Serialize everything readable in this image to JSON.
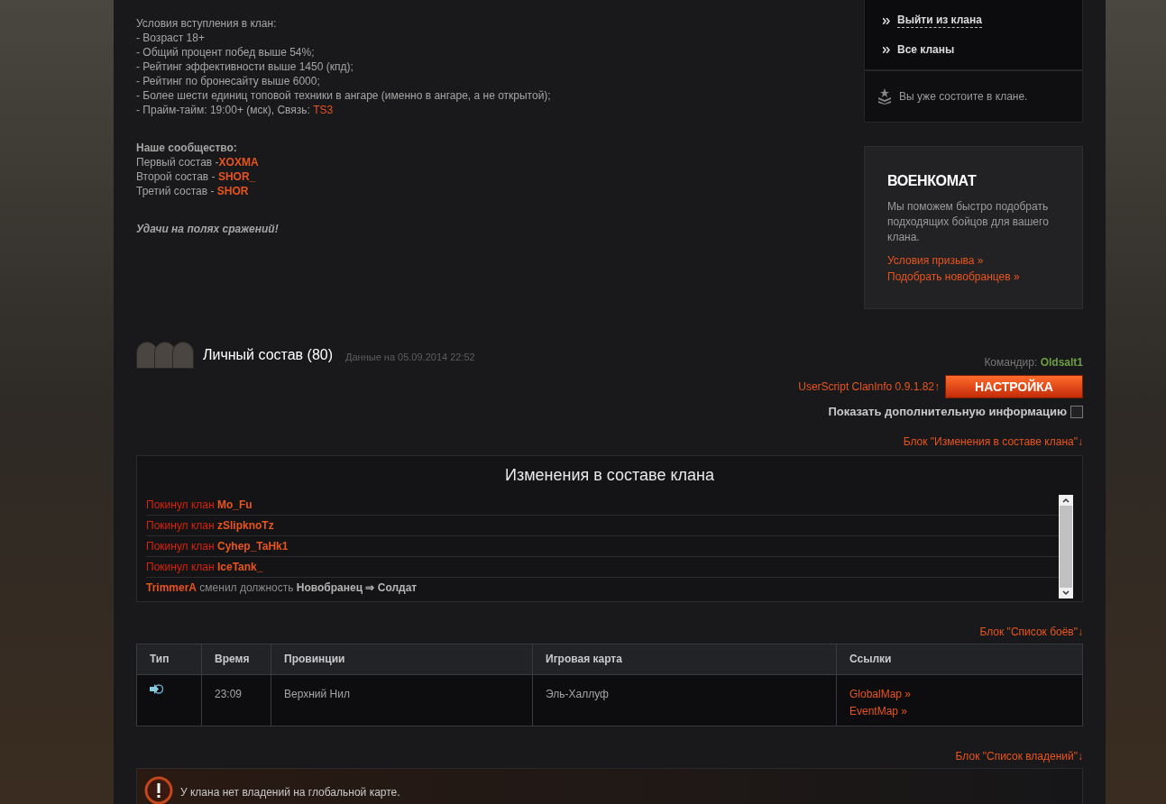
{
  "conditions": {
    "title": "Условия вступления в клан:",
    "lines": [
      {
        "text": "- Возраст 18+"
      },
      {
        "text": "- Общий процент побед выше 54%;"
      },
      {
        "text": "- Рейтинг эффективности выше 1450 (кпд);"
      },
      {
        "text": "- Рейтинг по бронесайту выше 6000;"
      },
      {
        "text": "- Более шести единиц топовой техники в ангаре (именно в ангаре, а не открытой);"
      },
      {
        "text": "- Прайм-тайм: 19:00+ (мск), Связь: ",
        "link": "TS3"
      }
    ]
  },
  "community": {
    "title": "Наше сообщество:",
    "rows": [
      {
        "label": "Первый состав -",
        "tag": "XOXMA"
      },
      {
        "label": "Второй состав - ",
        "tag": "SHOR_"
      },
      {
        "label": "Третий состав - ",
        "tag": "SHOR"
      }
    ]
  },
  "farewell": "Удачи на полях сражений!",
  "clan_actions": [
    {
      "label": "Выйти из клана",
      "dashed": true
    },
    {
      "label": "Все кланы",
      "dashed": false
    }
  ],
  "clan_status": "Вы уже состоите в клане.",
  "recruit": {
    "title": "ВОЕНКОМАТ",
    "text": "Мы поможем быстро подобрать подходящих бойцов для вашего клана.",
    "links": [
      "Условия призыва »",
      "Подобрать новобранцев »"
    ]
  },
  "roster": {
    "title": "Личный состав (80)",
    "date": "Данные на 05.09.2014 22:52",
    "commander_label": "Командир: ",
    "commander": "Oldsalt1",
    "userscript": "UserScript ClanInfo 0.9.1.82↑",
    "settings_button": "НАСТРОЙКА",
    "extra_info": {
      "label": "Показать дополнительную информацию",
      "checked": false
    }
  },
  "changes_block_link": "Блок \"Изменения в составе клана\"↓",
  "changes": {
    "title": "Изменения в составе клана",
    "entries": [
      {
        "kind": "left",
        "action": "Покинул клан ",
        "player": "Mo_Fu"
      },
      {
        "kind": "left",
        "action": "Покинул клан ",
        "player": "zSlipknoTz"
      },
      {
        "kind": "left",
        "action": "Покинул клан ",
        "player": "Cyhep_TaHk1"
      },
      {
        "kind": "left",
        "action": "Покинул клан ",
        "player": "IceTank_"
      },
      {
        "kind": "role",
        "player": "TrimmerA",
        "action": " сменил должность ",
        "change": "Новобранец ⇒ Солдат"
      }
    ]
  },
  "battles_block_link": "Блок \"Список боёв\"↓",
  "battles": {
    "columns": [
      "Тип",
      "Время",
      "Провинции",
      "Игровая карта",
      "Ссылки"
    ],
    "rows": [
      {
        "time": "23:09",
        "province": "Верхний Нил",
        "map": "Эль-Халлуф",
        "links": [
          "GlobalMap »",
          "EventMap »"
        ]
      }
    ]
  },
  "possessions_block_link": "Блок \"Список владений\"↓",
  "possessions_message": "У клана нет владений на глобальной карте."
}
